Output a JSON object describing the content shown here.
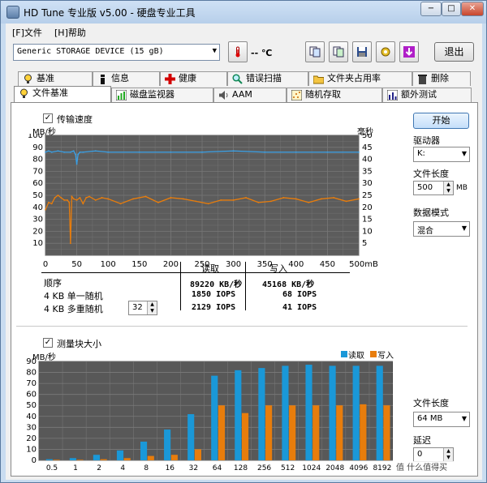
{
  "window": {
    "title": "HD Tune 专业版 v5.00 - 硬盘专业工具",
    "btn_min": "−",
    "btn_max": "□",
    "btn_close": "✕"
  },
  "menu": {
    "file": "[F]文件",
    "help": "[H]帮助"
  },
  "toolbar": {
    "drive": "Generic STORAGE DEVICE  (15 gB)",
    "temp": "-- ℃",
    "exit": "退出"
  },
  "tabs_top": [
    "基准",
    "信息",
    "健康",
    "错误扫描",
    "文件夹占用率",
    "删除"
  ],
  "tabs_bottom": [
    "文件基准",
    "磁盘监视器",
    "AAM",
    "随机存取",
    "额外测试"
  ],
  "transfer": {
    "checkbox_label": "传输速度",
    "y_left_unit": "MB/秒",
    "y_right_unit": "毫秒",
    "y_left_ticks": [
      "100",
      "90",
      "80",
      "70",
      "60",
      "50",
      "40",
      "30",
      "20",
      "10"
    ],
    "y_right_ticks": [
      "50",
      "45",
      "40",
      "35",
      "30",
      "25",
      "20",
      "15",
      "10",
      "5"
    ],
    "x_ticks": [
      "0",
      "50",
      "100",
      "150",
      "200",
      "250",
      "300",
      "350",
      "400",
      "450",
      "500mB"
    ]
  },
  "results": {
    "header_read": "读取",
    "header_write": "写入",
    "rows": [
      {
        "label": "顺序",
        "read": "89220 KB/秒",
        "write": "45168 KB/秒"
      },
      {
        "label": "4 KB 单一随机",
        "read": "1850 IOPS",
        "write": "68 IOPS"
      },
      {
        "label": "4 KB 多重随机",
        "read": "2129 IOPS",
        "write": "41 IOPS"
      }
    ],
    "queue_depth": "32"
  },
  "sidebar": {
    "start": "开始",
    "drive_label": "驱动器",
    "drive_value": "K:",
    "file_length_label": "文件长度",
    "file_length_value": "500",
    "file_length_unit": "MB",
    "data_mode_label": "数据模式",
    "data_mode_value": "混合",
    "file_length_label2": "文件长度",
    "file_length_value2": "64 MB",
    "delay_label": "延迟",
    "delay_value": "0"
  },
  "block": {
    "checkbox_label": "测量块大小",
    "y_unit": "MB/秒",
    "legend_read": "读取",
    "legend_write": "写入",
    "color_read": "#1a98d8",
    "color_write": "#e87d0c"
  },
  "watermark": "值 什么值得买",
  "chart_data": [
    {
      "type": "line",
      "title": "",
      "xlabel": "",
      "ylabel": "MB/秒",
      "xlim": [
        0,
        500
      ],
      "ylim": [
        0,
        100
      ],
      "y2lim": [
        0,
        50
      ],
      "grid": true,
      "series": [
        {
          "name": "",
          "color": "#3aa0e6",
          "x": [
            0,
            5,
            10,
            20,
            30,
            40,
            45,
            48,
            50,
            52,
            55,
            60,
            80,
            100,
            150,
            200,
            250,
            300,
            350,
            400,
            450,
            500
          ],
          "y": [
            86,
            87,
            86,
            87,
            86,
            86,
            87,
            84,
            76,
            84,
            86,
            86,
            87,
            86,
            86,
            86,
            86,
            87,
            86,
            86,
            86,
            86
          ]
        },
        {
          "name": "",
          "color": "#e87d0c",
          "x": [
            0,
            5,
            10,
            15,
            20,
            25,
            30,
            35,
            38,
            40,
            42,
            45,
            50,
            55,
            60,
            65,
            70,
            80,
            90,
            100,
            120,
            140,
            160,
            180,
            200,
            220,
            240,
            260,
            280,
            300,
            320,
            340,
            360,
            380,
            400,
            420,
            440,
            460,
            480,
            500
          ],
          "y": [
            38,
            44,
            43,
            48,
            50,
            48,
            46,
            46,
            44,
            10,
            49,
            47,
            46,
            48,
            43,
            48,
            49,
            46,
            48,
            47,
            43,
            47,
            49,
            44,
            48,
            47,
            45,
            43,
            46,
            46,
            48,
            44,
            45,
            48,
            47,
            44,
            47,
            48,
            45,
            47
          ]
        }
      ]
    },
    {
      "type": "bar",
      "title": "",
      "xlabel": "",
      "ylabel": "MB/秒",
      "ylim": [
        0,
        90
      ],
      "grid": true,
      "categories": [
        "0.5",
        "1",
        "2",
        "4",
        "8",
        "16",
        "32",
        "64",
        "128",
        "256",
        "512",
        "1024",
        "2048",
        "4096",
        "8192"
      ],
      "series": [
        {
          "name": "读取",
          "color": "#1a98d8",
          "values": [
            1,
            2,
            5,
            9,
            17,
            28,
            42,
            77,
            82,
            84,
            86,
            87,
            86,
            86,
            86
          ]
        },
        {
          "name": "写入",
          "color": "#e87d0c",
          "values": [
            0.5,
            0.5,
            1,
            2,
            4,
            5,
            10,
            50,
            43,
            50,
            50,
            50,
            50,
            51,
            50
          ]
        }
      ]
    }
  ]
}
